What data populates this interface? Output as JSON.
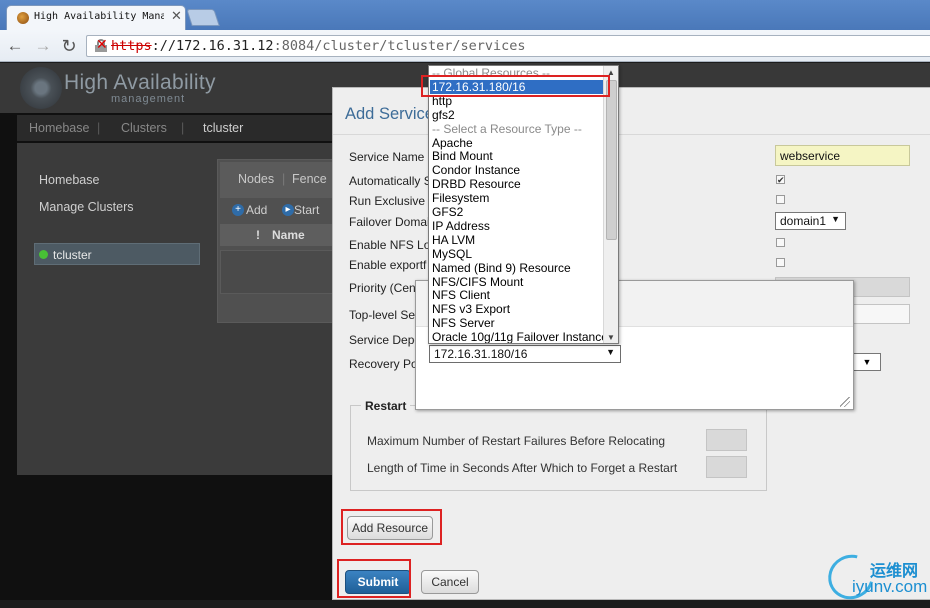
{
  "browser": {
    "tab_title": "High Availability Manag",
    "close_glyph": "✕",
    "url_scheme": "https",
    "url_host": "://172.16.31.12",
    "url_rest": ":8084/cluster/tcluster/services"
  },
  "app": {
    "logo_title": "High Availability",
    "logo_subtitle": "management",
    "breadcrumb": [
      "Homebase",
      "Clusters",
      "tcluster"
    ],
    "sidebar": [
      "Homebase",
      "Manage Clusters"
    ],
    "cluster_name": "tcluster",
    "tabs": [
      "Nodes",
      "Fence"
    ],
    "actions": {
      "add": "Add",
      "start": "Start"
    },
    "table_header": {
      "bang": "!",
      "name": "Name"
    }
  },
  "dialog": {
    "title": "Add Service",
    "labels": {
      "service_name": "Service Name",
      "auto_start": "Automatically S",
      "run_exclusive": "Run Exclusive",
      "failover_domain": "Failover Domai",
      "enable_nfs_lock": "Enable NFS Loc",
      "enable_exports": "Enable exportf",
      "priority": "Priority (Cen",
      "top_level": "Top-level Se",
      "service_dep": "Service Depe",
      "recovery_policy": "Recovery Po"
    },
    "service_name_value": "webservice",
    "auto_start_checked": true,
    "failover_domain_value": "domain1",
    "restart_legend": "Restart",
    "restart_max_label": "Maximum Number of Restart Failures Before Relocating",
    "restart_time_label": "Length of Time in Seconds After Which to Forget a Restart",
    "add_resource_label": "Add Resource",
    "submit_label": "Submit",
    "cancel_label": "Cancel"
  },
  "resource_select": {
    "selected_value": "172.16.31.180/16",
    "options": [
      {
        "label": "-- Global Resources --",
        "group": true
      },
      {
        "label": "172.16.31.180/16",
        "selected": true
      },
      {
        "label": "http"
      },
      {
        "label": "gfs2"
      },
      {
        "label": "-- Select a Resource Type --",
        "group": true
      },
      {
        "label": "Apache"
      },
      {
        "label": "Bind Mount"
      },
      {
        "label": "Condor Instance"
      },
      {
        "label": "DRBD Resource"
      },
      {
        "label": "Filesystem"
      },
      {
        "label": "GFS2"
      },
      {
        "label": "IP Address"
      },
      {
        "label": "HA LVM"
      },
      {
        "label": "MySQL"
      },
      {
        "label": "Named (Bind 9) Resource"
      },
      {
        "label": "NFS/CIFS Mount"
      },
      {
        "label": "NFS Client"
      },
      {
        "label": "NFS v3 Export"
      },
      {
        "label": "NFS Server"
      },
      {
        "label": "Oracle 10g/11g Failover Instance"
      }
    ]
  },
  "watermark": {
    "cn": "运维网",
    "en": "iyunv.com"
  },
  "colors": {
    "accent": "#3d6c98",
    "selection": "#2f6ec4",
    "highlight": "#dd2222",
    "input_yellow": "#f5f5c4"
  },
  "icons": [
    "favicon-icon",
    "back-icon",
    "forward-icon",
    "reload-icon",
    "broken-lock-icon",
    "add-icon",
    "start-icon",
    "chevron-down-icon",
    "resize-handle-icon"
  ]
}
